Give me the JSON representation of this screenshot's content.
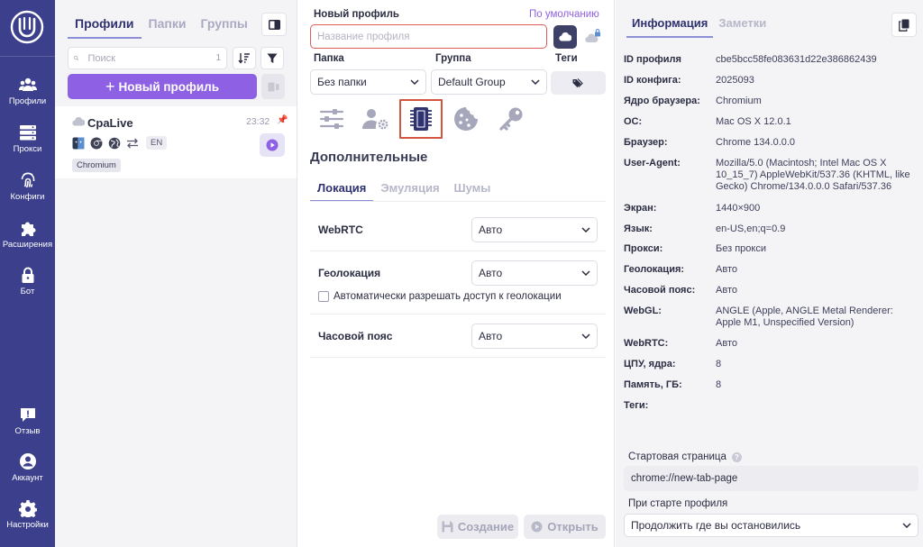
{
  "nav": {
    "items": [
      {
        "label": "Профили",
        "icon": "profiles-icon"
      },
      {
        "label": "Прокси",
        "icon": "proxy-icon"
      },
      {
        "label": "Конфиги",
        "icon": "fingerprint-icon"
      },
      {
        "label": "Расширения",
        "icon": "puzzle-icon"
      },
      {
        "label": "Бот",
        "icon": "lock-icon"
      }
    ],
    "bottom": [
      {
        "label": "Отзыв",
        "icon": "feedback-icon"
      },
      {
        "label": "Аккаунт",
        "icon": "account-icon"
      },
      {
        "label": "Настройки",
        "icon": "settings-icon"
      }
    ]
  },
  "profiles": {
    "tabs": [
      "Профили",
      "Папки",
      "Группы"
    ],
    "search": {
      "placeholder": "Поиск",
      "count": "1"
    },
    "new_button": "Новый профиль",
    "items": [
      {
        "name": "CpaLive",
        "time": "23:32",
        "lang": "EN",
        "badge": "Chromium"
      }
    ]
  },
  "editor": {
    "title": "Новый профиль",
    "default_link": "По умолчанию",
    "name_placeholder": "Название профиля",
    "folder_label": "Папка",
    "folder_value": "Без папки",
    "group_label": "Группа",
    "group_value": "Default Group",
    "tags_label": "Теги",
    "section_title": "Дополнительные",
    "subtabs": [
      "Локация",
      "Эмуляция",
      "Шумы"
    ],
    "rows": [
      {
        "label": "WebRTC",
        "value": "Авто"
      },
      {
        "label": "Геолокация",
        "value": "Авто"
      },
      {
        "label": "Часовой пояс",
        "value": "Авто"
      }
    ],
    "geo_checkbox": "Автоматически разрешать доступ к геолокации",
    "create_button": "Создание",
    "open_button": "Открыть"
  },
  "info": {
    "tabs": [
      "Информация",
      "Заметки"
    ],
    "fields": [
      {
        "key": "ID профиля",
        "value": "cbe5bcc58fe083631d22e386862439"
      },
      {
        "key": "ID конфига:",
        "value": "2025093"
      },
      {
        "key": "Ядро браузера:",
        "value": "Chromium"
      },
      {
        "key": "ОС:",
        "value": "Mac OS X 12.0.1"
      },
      {
        "key": "Браузер:",
        "value": "Chrome 134.0.0.0"
      },
      {
        "key": "User-Agent:",
        "value": "Mozilla/5.0 (Macintosh; Intel Mac OS X 10_15_7) AppleWebKit/537.36 (KHTML, like Gecko) Chrome/134.0.0.0 Safari/537.36"
      },
      {
        "key": "Экран:",
        "value": "1440×900"
      },
      {
        "key": "Язык:",
        "value": "en-US,en;q=0.9"
      },
      {
        "key": "Прокси:",
        "value": "Без прокси"
      },
      {
        "key": "Геолокация:",
        "value": "Авто"
      },
      {
        "key": "Часовой пояс:",
        "value": "Авто"
      },
      {
        "key": "WebGL:",
        "value": "ANGLE (Apple, ANGLE Metal Renderer: Apple M1, Unspecified Version)"
      },
      {
        "key": "WebRTC:",
        "value": "Авто"
      },
      {
        "key": "ЦПУ, ядра:",
        "value": "8"
      },
      {
        "key": "Память, ГБ:",
        "value": "8"
      },
      {
        "key": "Теги:",
        "value": ""
      }
    ],
    "start_page_label": "Стартовая страница",
    "start_page_value": "chrome://new-tab-page",
    "on_start_label": "При старте профиля",
    "on_start_value": "Продолжить где вы остановились"
  },
  "colors": {
    "nav_bg": "#3b3f8c",
    "accent": "#8e60e3",
    "error_border": "#e15a5a",
    "selected_outline": "#d4543f"
  }
}
